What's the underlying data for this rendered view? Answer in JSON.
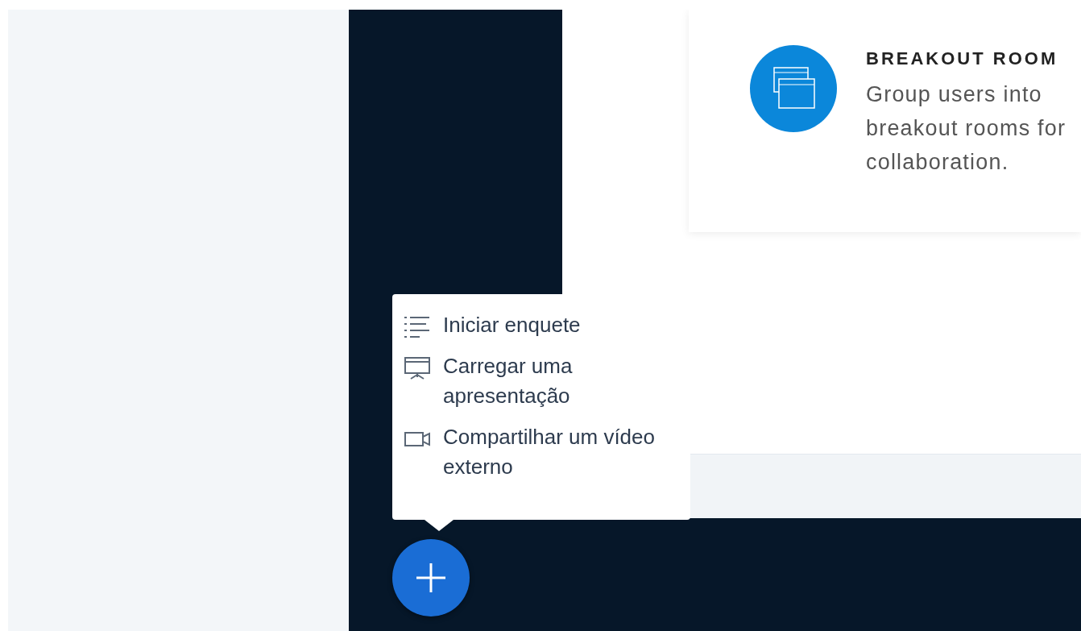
{
  "feature_card": {
    "title": "BREAKOUT ROOM",
    "description": "Group users into breakout rooms for collaboration."
  },
  "actions_menu": {
    "items": [
      {
        "kind": "poll",
        "label": "Iniciar enquete"
      },
      {
        "kind": "presentation",
        "label": "Carregar uma apresentação"
      },
      {
        "kind": "video",
        "label": "Compartilhar um vídeo externo"
      }
    ]
  },
  "plus_button": {
    "expanded": true
  }
}
